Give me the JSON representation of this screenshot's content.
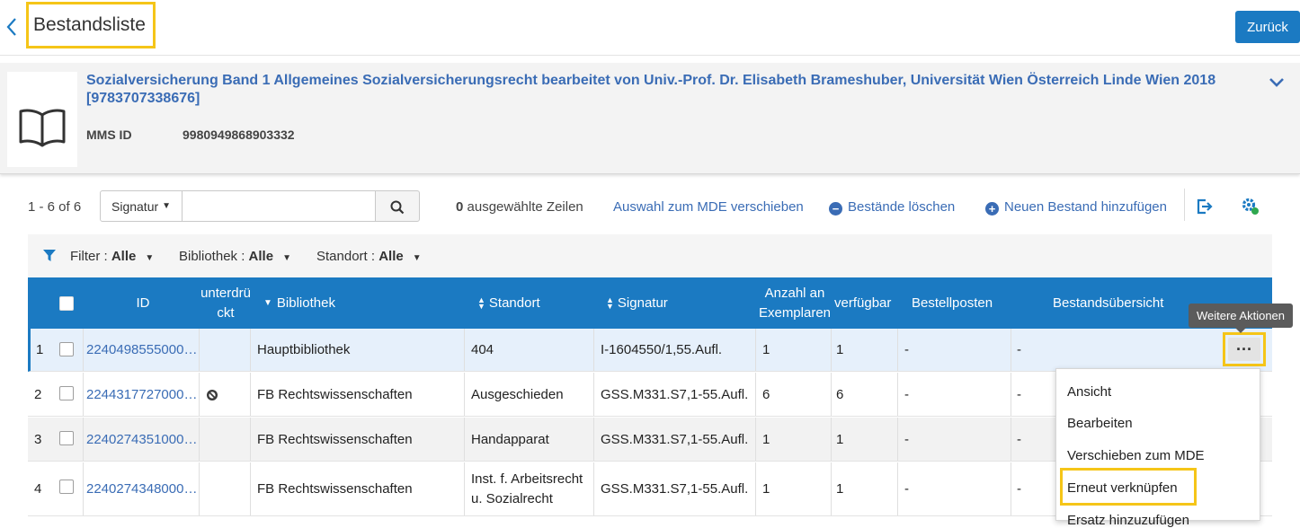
{
  "header": {
    "title": "Bestandsliste",
    "back_button": "Zurück"
  },
  "record": {
    "title": "Sozialversicherung Band 1 Allgemeines Sozialversicherungsrecht bearbeitet von Univ.-Prof. Dr. Elisabeth Brameshuber, Universität Wien Österreich Linde Wien 2018 [9783707338676]",
    "mms_label": "MMS ID",
    "mms_value": "9980949868903332",
    "icon": "book-icon"
  },
  "toolbar": {
    "range": "1 - 6 of 6",
    "search_field": "Signatur",
    "search_value": "",
    "selected_count": "0",
    "selected_label": "ausgewählte Zeilen",
    "move_link": "Auswahl zum MDE verschieben",
    "delete_link": "Bestände löschen",
    "add_link": "Neuen Bestand hinzufügen"
  },
  "filters": [
    {
      "label": "Filter :",
      "value": "Alle"
    },
    {
      "label": "Bibliothek :",
      "value": "Alle"
    },
    {
      "label": "Standort :",
      "value": "Alle"
    }
  ],
  "table": {
    "headers": {
      "id": "ID",
      "suppressed_line1": "unterdrü",
      "suppressed_line2": "ckt",
      "library": "Bibliothek",
      "location": "Standort",
      "call_number": "Signatur",
      "items_line1": "Anzahl an",
      "items_line2": "Exemplaren",
      "available": "verfügbar",
      "orders": "Bestellposten",
      "summary": "Bestandsübersicht"
    },
    "rows": [
      {
        "num": "1",
        "id": "2240498555000…",
        "library": "Hauptbibliothek",
        "location": "404",
        "location2": "",
        "call_number": "I-1604550/1,55.Aufl.",
        "items": "1",
        "available": "1",
        "orders": "-",
        "summary": "-"
      },
      {
        "num": "2",
        "id": "2244317727000…",
        "library": "FB Rechtswissenschaften",
        "location": "Ausgeschieden",
        "location2": "",
        "call_number": "GSS.M331.S7,1-55.Aufl.",
        "items": "6",
        "available": "6",
        "orders": "-",
        "summary": "-"
      },
      {
        "num": "3",
        "id": "2240274351000…",
        "library": "FB Rechtswissenschaften",
        "location": "Handapparat",
        "location2": "",
        "call_number": "GSS.M331.S7,1-55.Aufl.",
        "items": "1",
        "available": "1",
        "orders": "-",
        "summary": "-"
      },
      {
        "num": "4",
        "id": "2240274348000…",
        "library": "FB Rechtswissenschaften",
        "location": "Inst. f. Arbeitsrecht",
        "location2": "u. Sozialrecht",
        "call_number": "GSS.M331.S7,1-55.Aufl.",
        "items": "1",
        "available": "1",
        "orders": "-",
        "summary": "-"
      }
    ]
  },
  "tooltip": "Weitere Aktionen",
  "more_button": "···",
  "row_menu": [
    "Ansicht",
    "Bearbeiten",
    "Verschieben zum MDE",
    "Erneut verknüpfen",
    "Ersatz hinzuzufügen"
  ],
  "colors": {
    "accent": "#1b7ac2",
    "link": "#3a6cb5",
    "highlight": "#f5c518"
  }
}
